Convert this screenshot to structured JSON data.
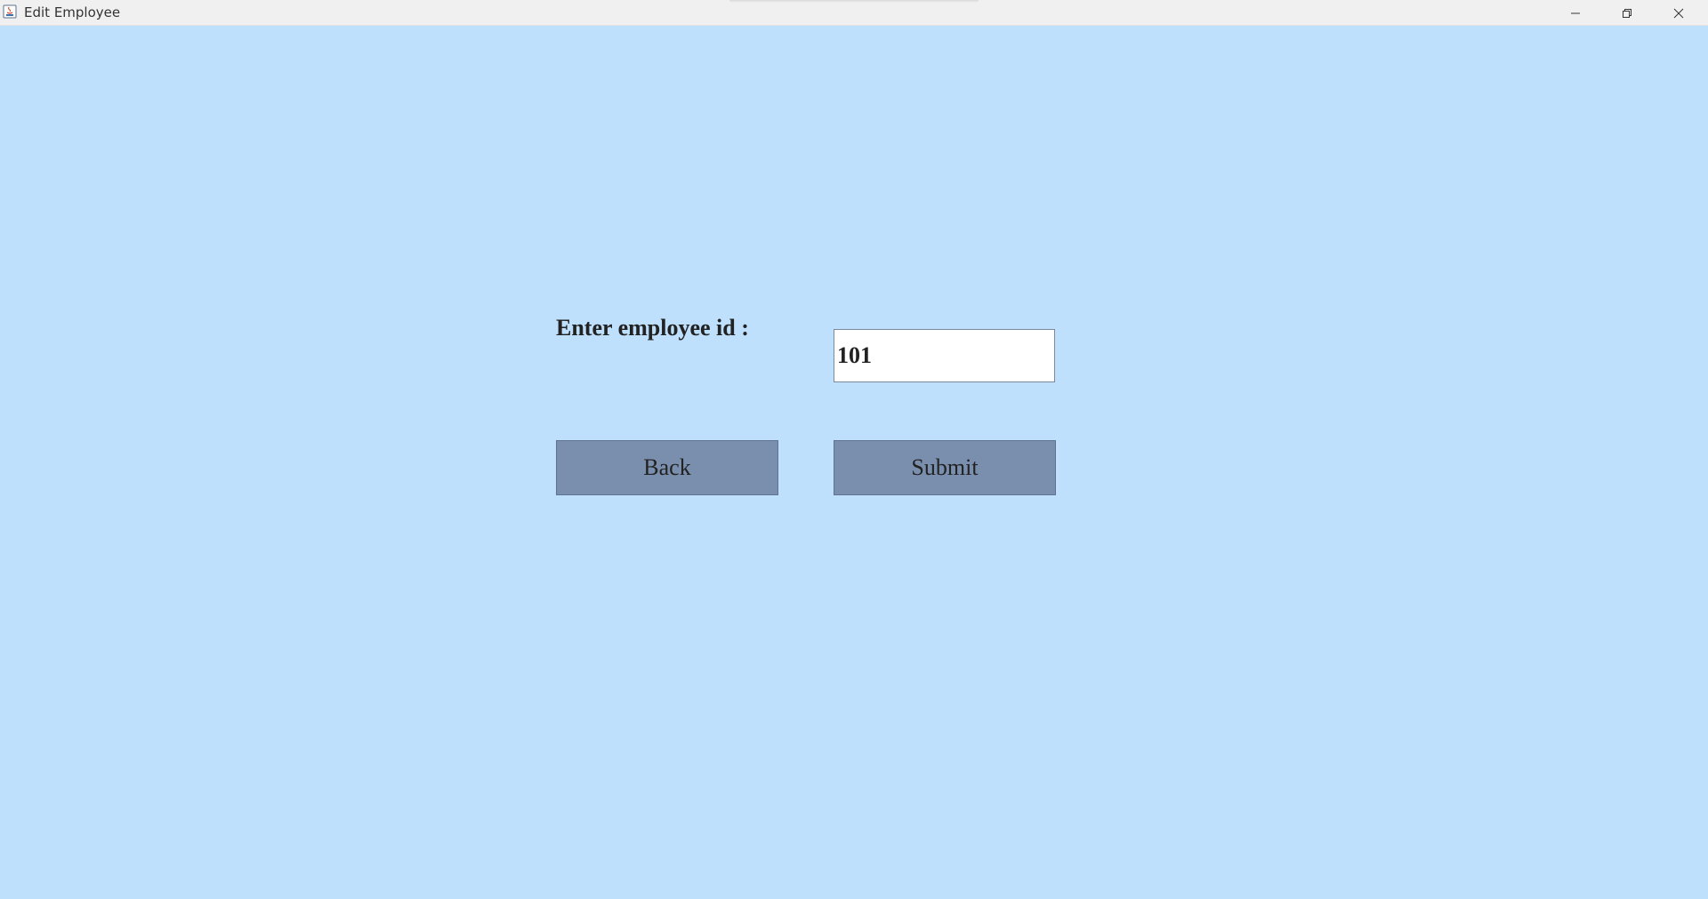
{
  "window": {
    "title": "Edit Employee",
    "icon": "java-app-icon",
    "controls": {
      "minimize_icon": "minimize-icon",
      "maximize_icon": "restore-icon",
      "close_icon": "close-icon"
    }
  },
  "form": {
    "employee_id_label": "Enter employee id :",
    "employee_id_value": "101",
    "back_label": "Back",
    "submit_label": "Submit"
  },
  "colors": {
    "background": "#bee0fc",
    "button": "#7a8fae",
    "titlebar": "#f0f0f0"
  }
}
